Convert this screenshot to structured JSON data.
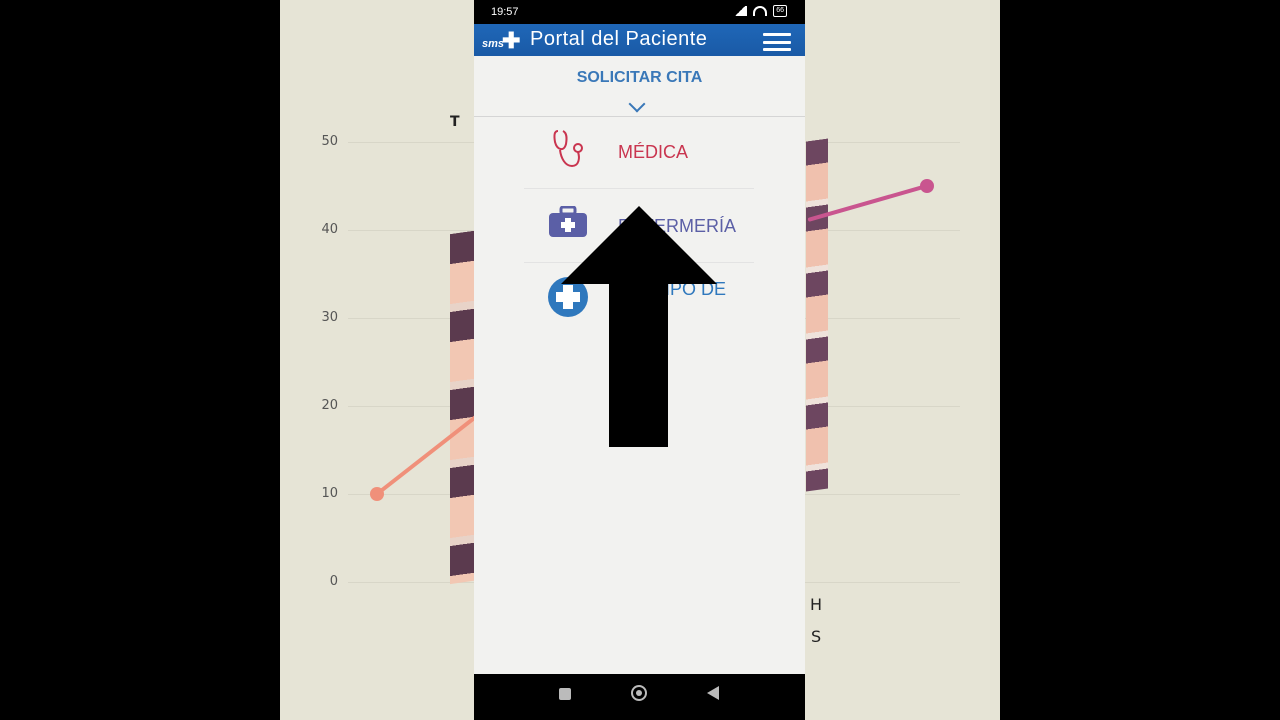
{
  "status_bar": {
    "time": "19:57",
    "battery": "66"
  },
  "app_bar": {
    "logo_text": "sms",
    "title": "Portal del Paciente"
  },
  "section": {
    "title": "SOLICITAR CITA"
  },
  "menu": {
    "items": [
      {
        "label": "MÉDICA",
        "color": "#c9354f",
        "icon": "stethoscope-icon"
      },
      {
        "label": "ENFERMERÍA",
        "visible_label": "E··ERMERÍA",
        "color": "#5b5fa6",
        "icon": "medical-kit-icon"
      },
      {
        "label": "TIPO DE",
        "color": "#2f78bd",
        "icon": "plus-circle-icon"
      }
    ]
  },
  "overlay": {
    "arrow": "up-arrow"
  },
  "background": {
    "title": "T H",
    "y_ticks": [
      "50",
      "40",
      "30",
      "20",
      "10",
      "0"
    ],
    "letters": [
      "H",
      "S"
    ],
    "line_colors": [
      "#f0907a",
      "#c9558f"
    ]
  },
  "nav_bar": {
    "buttons": [
      "recents",
      "home",
      "back"
    ]
  }
}
